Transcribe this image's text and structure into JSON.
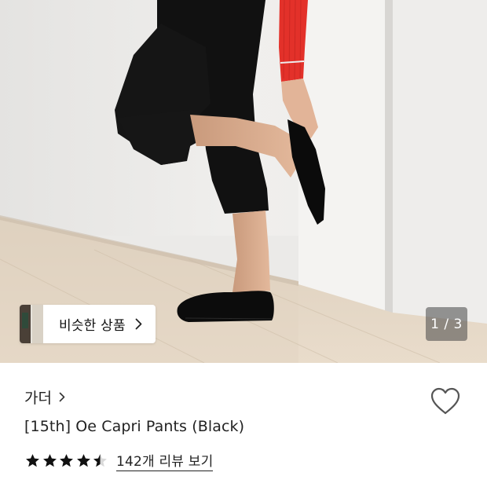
{
  "gallery": {
    "similar_label": "비슷한 상품",
    "counter": "1 / 3",
    "current_index": 1,
    "total_images": 3
  },
  "product": {
    "brand": "가더",
    "title": "[15th] Oe Capri Pants (Black)",
    "rating": 4.5,
    "rating_max": 5,
    "review_link": "142개 리뷰 보기"
  },
  "icons": {
    "similar_chevron": "chevron-right-icon",
    "brand_chevron": "chevron-right-icon",
    "wishlist": "heart-outline-icon",
    "star": "star-icon"
  },
  "colors": {
    "text": "#222222",
    "star": "#111111",
    "star_empty": "#d9d9d9",
    "heart_stroke": "#555555",
    "counter_bg": "#7a7a7a"
  }
}
